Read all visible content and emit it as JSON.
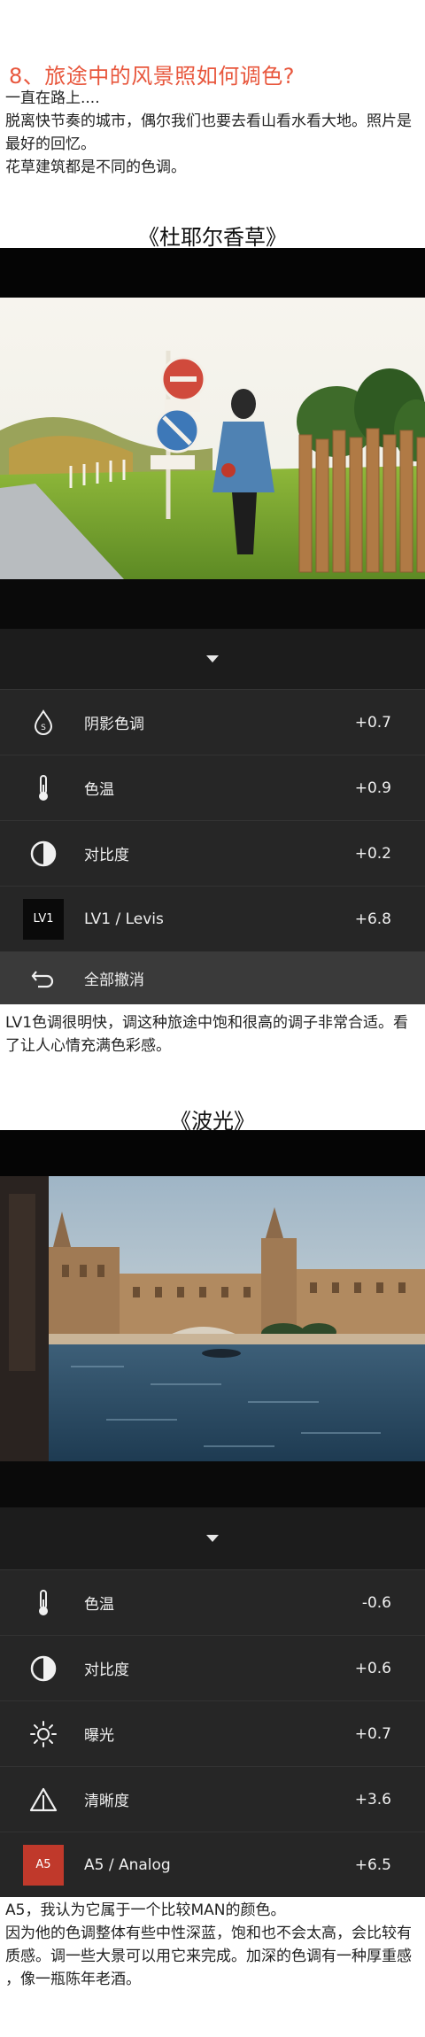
{
  "article": {
    "title": "8、旅途中的风景照如何调色?",
    "intro_lines": [
      "一直在路上....",
      "脱离快节奏的城市，偶尔我们也要去看山看水看大地。照片是",
      "最好的回忆。",
      "花草建筑都是不同的色调。"
    ]
  },
  "section1": {
    "caption": "《杜耶尔香草》",
    "adjustments": [
      {
        "icon": "shadow-tone-icon",
        "label": "阴影色调",
        "value": "+0.7"
      },
      {
        "icon": "thermometer-icon",
        "label": "色温",
        "value": "+0.9"
      },
      {
        "icon": "contrast-icon",
        "label": "对比度",
        "value": "+0.2"
      },
      {
        "icon": "preset-lv1-icon",
        "label": "LV1 / Levis",
        "value": "+6.8",
        "tile_text": "LV1"
      }
    ],
    "undo_label": "全部撤消",
    "note_lines": [
      "LV1色调很明快，调这种旅途中饱和很高的调子非常合适。看",
      "了让人心情充满色彩感。"
    ]
  },
  "section2": {
    "caption": "《波光》",
    "adjustments": [
      {
        "icon": "thermometer-icon",
        "label": "色温",
        "value": "-0.6"
      },
      {
        "icon": "contrast-icon",
        "label": "对比度",
        "value": "+0.6"
      },
      {
        "icon": "exposure-icon",
        "label": "曝光",
        "value": "+0.7"
      },
      {
        "icon": "clarity-icon",
        "label": "清晰度",
        "value": "+3.6"
      },
      {
        "icon": "preset-a5-icon",
        "label": "A5 / Analog",
        "value": "+6.5",
        "tile_text": "A5"
      }
    ],
    "note_lines": [
      "A5，我认为它属于一个比较MAN的颜色。",
      "因为他的色调整体有些中性深蓝，饱和也不会太高，会比较有",
      "质感。调一些大景可以用它来完成。加深的色调有一种厚重感",
      "，像一瓶陈年老酒。"
    ]
  },
  "colors": {
    "title_accent": "#e8573d",
    "panel_row": "#262626",
    "panel_undo": "#3a3a3a",
    "preset_lv1": "#0a0a0a",
    "preset_a5": "#c0392b"
  }
}
